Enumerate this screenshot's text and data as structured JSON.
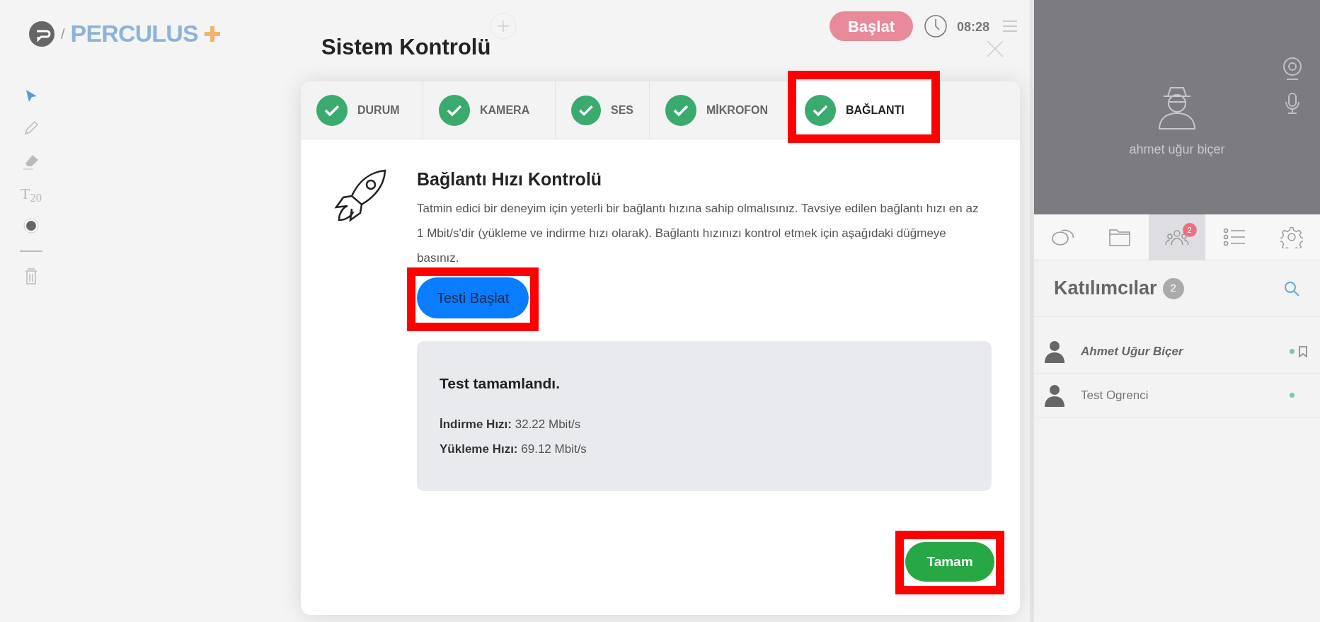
{
  "app": {
    "separator": "/",
    "logo_text": "PERCULUS"
  },
  "tools": [
    {
      "kind": "pointer",
      "selected": true
    },
    {
      "kind": "pencil",
      "selected": false
    },
    {
      "kind": "eraser",
      "selected": false
    },
    {
      "kind": "text",
      "label": "T$_{20}$",
      "selected": false
    },
    {
      "kind": "color",
      "selected": false
    },
    {
      "kind": "line",
      "selected": false
    },
    {
      "kind": "trash",
      "selected": false
    }
  ],
  "top_bar": {
    "start_button": "Başlat",
    "timer": "08:28"
  },
  "modal": {
    "title": "Sistem Kontrolü",
    "tabs": [
      {
        "label": "DURUM",
        "done": true,
        "selected": false,
        "highlighted": false
      },
      {
        "label": "KAMERA",
        "done": true,
        "selected": false,
        "highlighted": false
      },
      {
        "label": "SES",
        "done": true,
        "selected": false,
        "highlighted": false
      },
      {
        "label": "MİKROFON",
        "done": true,
        "selected": false,
        "highlighted": false
      },
      {
        "label": "BAĞLANTI",
        "done": true,
        "selected": true,
        "highlighted": true
      }
    ],
    "heading": "Bağlantı Hızı Kontrolü",
    "description": "Tatmin edici bir deneyim için yeterli bir bağlantı hızına sahip olmalısınız. Tavsiye edilen bağlantı hızı en az 1 Mbit/s'dir (yükleme ve indirme hızı olarak). Bağlantı hızınızı kontrol etmek için aşağıdaki düğmeye basınız.",
    "test_button": {
      "label": "Testi Başlat",
      "highlighted": true
    },
    "result": {
      "title": "Test tamamlandı.",
      "rows": [
        {
          "label": "İndirme Hızı:",
          "value": "32.22 Mbit/s"
        },
        {
          "label": "Yükleme Hızı:",
          "value": "69.12 Mbit/s"
        }
      ]
    },
    "ok_button": {
      "label": "Tamam",
      "highlighted": true
    }
  },
  "video": {
    "name": "ahmet uğur biçer"
  },
  "side_tabs": [
    {
      "kind": "chat",
      "selected": false
    },
    {
      "kind": "folder",
      "selected": false
    },
    {
      "kind": "participants",
      "selected": true,
      "badge": "2"
    },
    {
      "kind": "list",
      "selected": false
    },
    {
      "kind": "settings",
      "selected": false
    }
  ],
  "participants": {
    "title": "Katılımcılar",
    "count": "2",
    "items": [
      {
        "name": "Ahmet Uğur Biçer",
        "host": true,
        "online": true
      },
      {
        "name": "Test Ogrenci",
        "host": false,
        "online": true
      }
    ]
  }
}
